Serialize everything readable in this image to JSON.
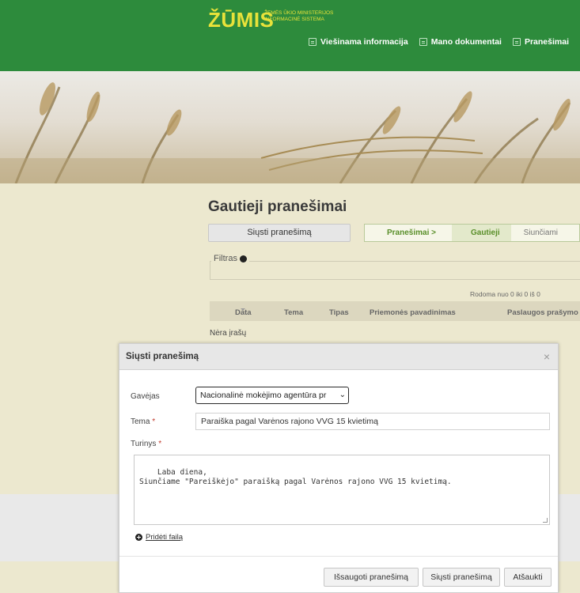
{
  "header": {
    "logo": "ŽŪMIS",
    "logo_sub_line1": "ŽEMĖS ŪKIO MINISTERIJOS",
    "logo_sub_line2": "INFORMACINĖ SISTEMA",
    "nav": [
      {
        "label": "Viešinama informacija",
        "icon": "document-icon"
      },
      {
        "label": "Mano dokumentai",
        "icon": "document-icon"
      },
      {
        "label": "Pranešimai",
        "icon": "envelope-icon"
      }
    ]
  },
  "page": {
    "title": "Gautieji pranešimai",
    "send_button": "Siųsti pranešimą",
    "tabs": [
      {
        "label": "Pranešimai >"
      },
      {
        "label": "Gautieji",
        "active": true
      },
      {
        "label": "Siunčiami"
      }
    ],
    "filter_label": "Filtras",
    "showing_text": "Rodoma nuo 0 iki 0 iš 0",
    "columns": [
      "Data",
      "Tema",
      "Tipas",
      "Priemonės pavadinimas",
      "Paslaugos prašymo"
    ],
    "empty_text": "Nėra įrašų"
  },
  "modal": {
    "title": "Siųsti pranešimą",
    "close": "×",
    "recipient_label": "Gavėjas",
    "recipient_value": "Nacionalinė mokėjimo agentūra pr",
    "subject_label": "Tema",
    "subject_value": "Paraiška pagal Varėnos rajono VVG 15 kvietimą",
    "body_label": "Turinys",
    "body_value": "Laba diena,\nSiunčiame \"Pareiškėjo\" paraišką pagal Varėnos rajono VVG 15 kvietimą.",
    "attach_label": "Pridėti failą",
    "required_mark": "*",
    "buttons": {
      "save": "Išsaugoti pranešimą",
      "send": "Siųsti pranešimą",
      "cancel": "Atšaukti"
    }
  },
  "colors": {
    "header_green": "#2d8b3c",
    "logo_yellow": "#e8e23a",
    "content_bg": "#ece8cf",
    "tab_green": "#5a8f2a"
  }
}
